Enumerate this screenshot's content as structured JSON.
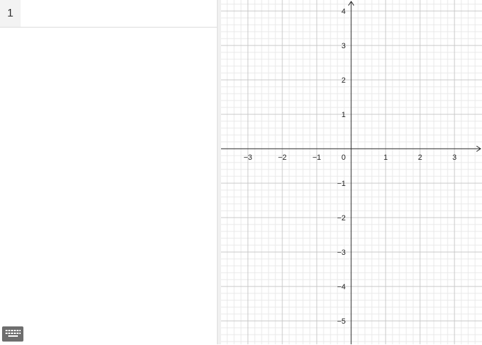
{
  "algebra": {
    "row_number": "1",
    "input_value": ""
  },
  "keyboard": {
    "icon": "keyboard-icon"
  },
  "graph": {
    "x_range": [
      -3.7,
      3.75
    ],
    "y_range": [
      -5.6,
      4.3
    ],
    "grid": true,
    "minor_grid_step": 0.2,
    "major_grid_step": 1,
    "x_tick_labels": [
      "−3",
      "−2",
      "−1",
      "1",
      "2",
      "3"
    ],
    "y_tick_labels": [
      "4",
      "3",
      "2",
      "1",
      "−1",
      "−2",
      "−3",
      "−4",
      "−5"
    ],
    "origin_label": "0",
    "colors": {
      "minor_grid": "#e8e8e8",
      "major_grid": "#c8c8c8",
      "axes": "#222222",
      "keyboard_button": "#6e6e6e"
    }
  }
}
